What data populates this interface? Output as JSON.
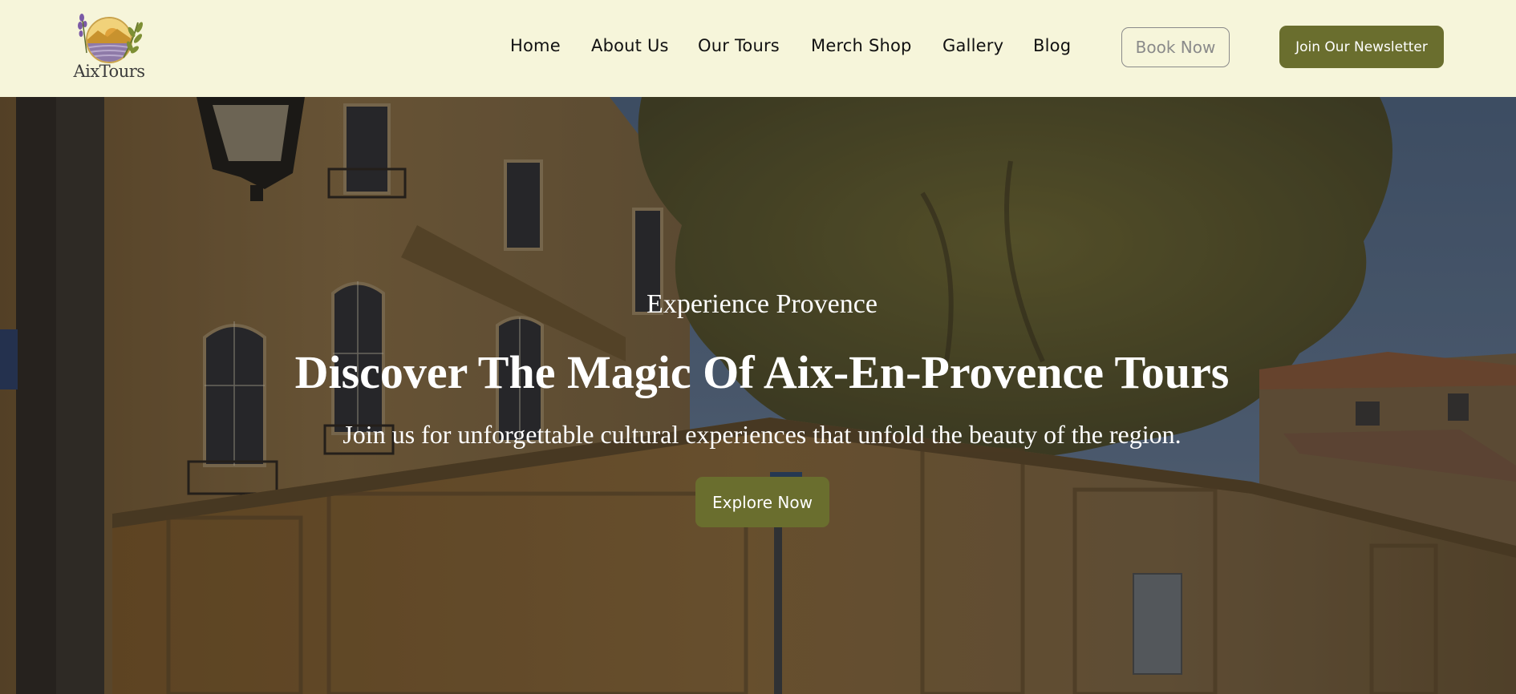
{
  "brand": {
    "name": "AixTours",
    "logo_icon": "lavender-olive-sun-emblem-icon",
    "accent_color": "#6a6e2e",
    "header_bg": "#f6f5da"
  },
  "nav": {
    "items": [
      {
        "label": "Home"
      },
      {
        "label": "About Us"
      },
      {
        "label": "Our Tours"
      },
      {
        "label": "Merch Shop"
      },
      {
        "label": "Gallery"
      },
      {
        "label": "Blog"
      }
    ],
    "book_label": "Book Now",
    "newsletter_label": "Join Our Newsletter"
  },
  "hero": {
    "eyebrow": "Experience Provence",
    "title": "Discover The Magic Of Aix-En-Provence Tours",
    "subtitle": "Join us for unforgettable cultural experiences that unfold the beauty of the region.",
    "cta_label": "Explore Now"
  }
}
